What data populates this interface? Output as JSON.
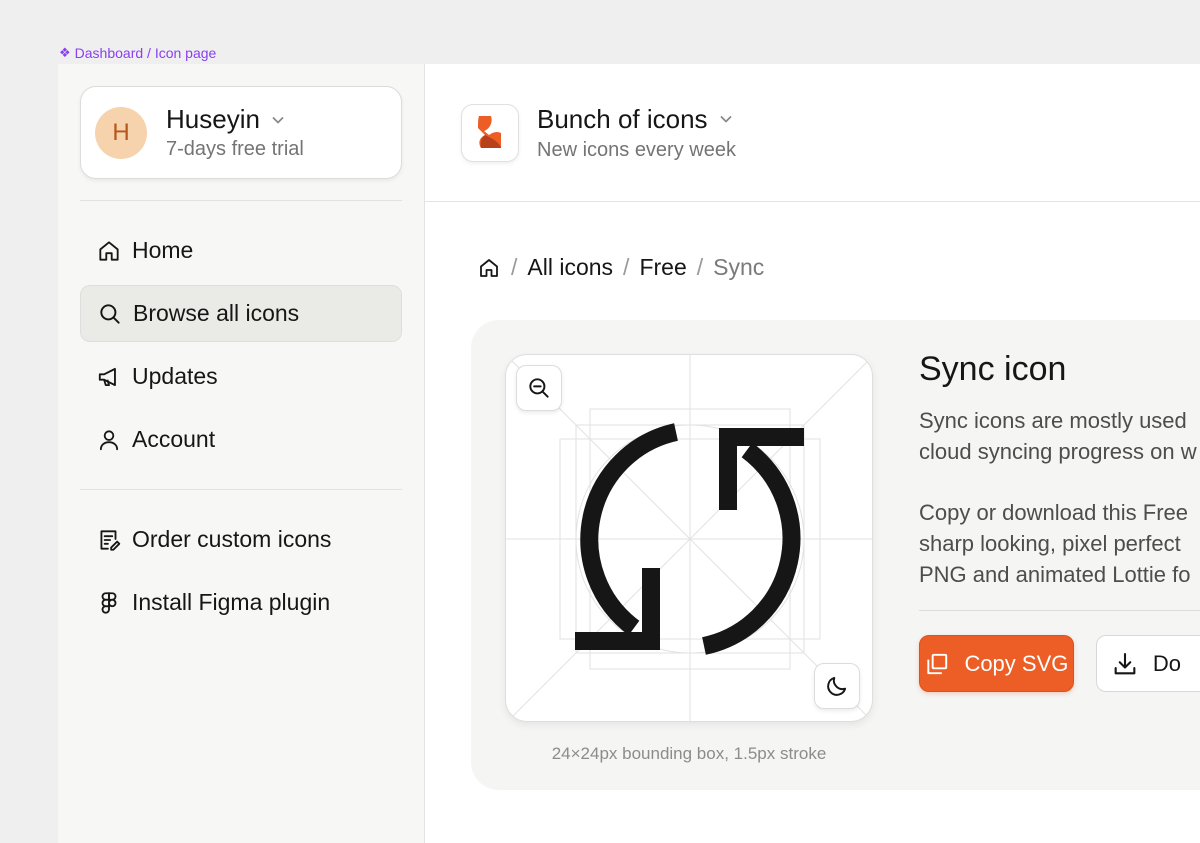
{
  "frame_label": "Dashboard / Icon page",
  "account": {
    "initial": "H",
    "name": "Huseyin",
    "plan": "7-days free trial"
  },
  "nav": {
    "home": "Home",
    "browse": "Browse all icons",
    "updates": "Updates",
    "account": "Account",
    "order": "Order custom icons",
    "figma": "Install Figma plugin"
  },
  "brand": {
    "name": "Bunch of icons",
    "tagline": "New icons every week"
  },
  "breadcrumb": {
    "sep": "/",
    "all": "All icons",
    "free": "Free",
    "current": "Sync"
  },
  "icon_detail": {
    "title": "Sync icon",
    "desc_line1": "Sync icons are mostly used",
    "desc_line2": "cloud syncing progress on w",
    "copy_line1": "Copy or download this Free",
    "copy_line2": "sharp looking, pixel perfect",
    "copy_line3": "PNG and animated Lottie fo",
    "caption": "24×24px bounding box, 1.5px stroke",
    "copy_button": "Copy SVG",
    "download_button": "Do"
  },
  "colors": {
    "accent": "#ec5e25",
    "frame_label": "#8a3ff0",
    "avatar_bg": "#f6d2ad",
    "active_nav": "#eaeae6"
  }
}
